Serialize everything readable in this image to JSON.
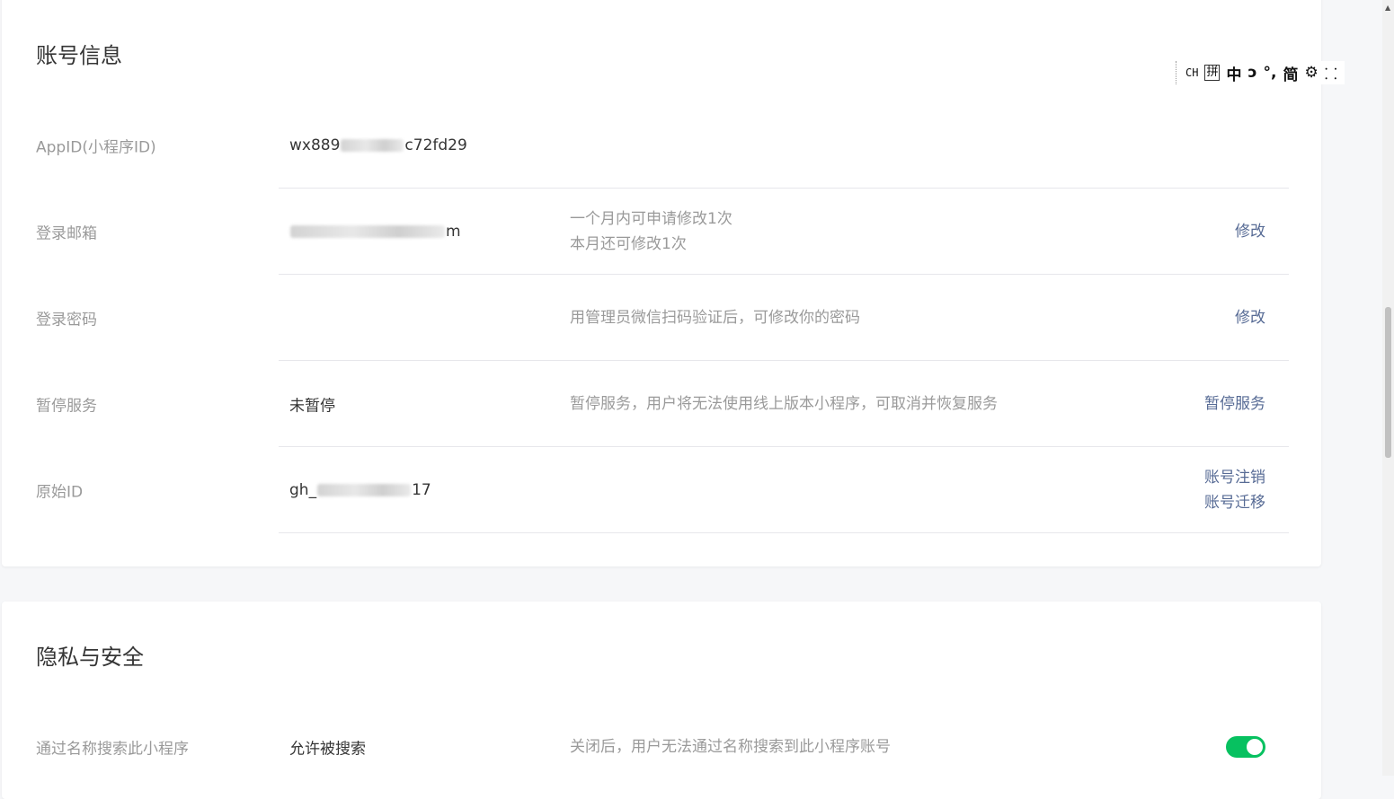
{
  "account_section": {
    "title": "账号信息",
    "rows": [
      {
        "label": "AppID(小程序ID)",
        "value_prefix": "wx889",
        "value_suffix": "c72fd29"
      },
      {
        "label": "登录邮箱",
        "value_suffix": "m",
        "desc_line1": "一个月内可申请修改1次",
        "desc_line2": "本月还可修改1次",
        "action": "修改"
      },
      {
        "label": "登录密码",
        "desc_line1": "用管理员微信扫码验证后，可修改你的密码",
        "action": "修改"
      },
      {
        "label": "暂停服务",
        "value": "未暂停",
        "desc_line1": "暂停服务，用户将无法使用线上版本小程序，可取消并恢复服务",
        "action": "暂停服务"
      },
      {
        "label": "原始ID",
        "value_prefix": "gh_",
        "value_suffix": "17",
        "action1": "账号注销",
        "action2": "账号迁移"
      }
    ]
  },
  "privacy_section": {
    "title": "隐私与安全",
    "rows": [
      {
        "label": "通过名称搜索此小程序",
        "value": "允许被搜索",
        "desc_line1": "关闭后，用户无法通过名称搜索到此小程序账号",
        "toggle_on": true
      }
    ]
  },
  "ime_toolbar": {
    "items": [
      "CH",
      "拼",
      "中",
      "ↄ",
      "°,",
      "简",
      "⚙",
      "⸬"
    ]
  },
  "colors": {
    "link": "#576b95",
    "toggle_on": "#07c160",
    "label": "#9a9a9a",
    "text": "#353535"
  }
}
